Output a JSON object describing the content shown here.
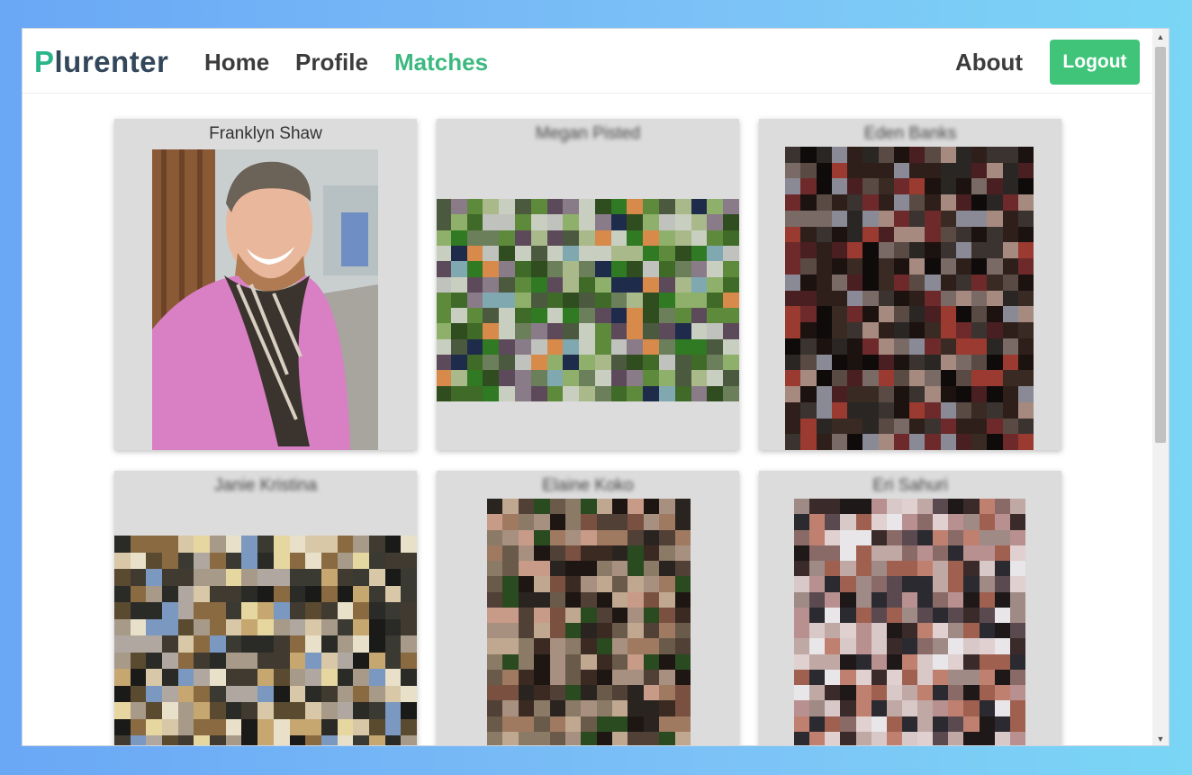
{
  "nav": {
    "brand_first": "P",
    "brand_rest": "lurenter",
    "links": [
      "Home",
      "Profile",
      "Matches",
      "About"
    ],
    "active": "Matches",
    "logout_label": "Logout"
  },
  "matches": [
    {
      "name": "Franklyn Shaw",
      "blurred": false
    },
    {
      "name": "Megan Pisted",
      "blurred": true
    },
    {
      "name": "Eden Banks",
      "blurred": true
    },
    {
      "name": "Janie Kristina",
      "blurred": true
    },
    {
      "name": "Elaine Koko",
      "blurred": true
    },
    {
      "name": "Eri Sahuri",
      "blurred": true
    }
  ],
  "colors": {
    "accent_green": "#3cb880",
    "logout_bg": "#3fc47a",
    "card_bg": "#dcdcdc"
  },
  "icons": {
    "scroll_up": "▲",
    "scroll_down": "▼"
  }
}
